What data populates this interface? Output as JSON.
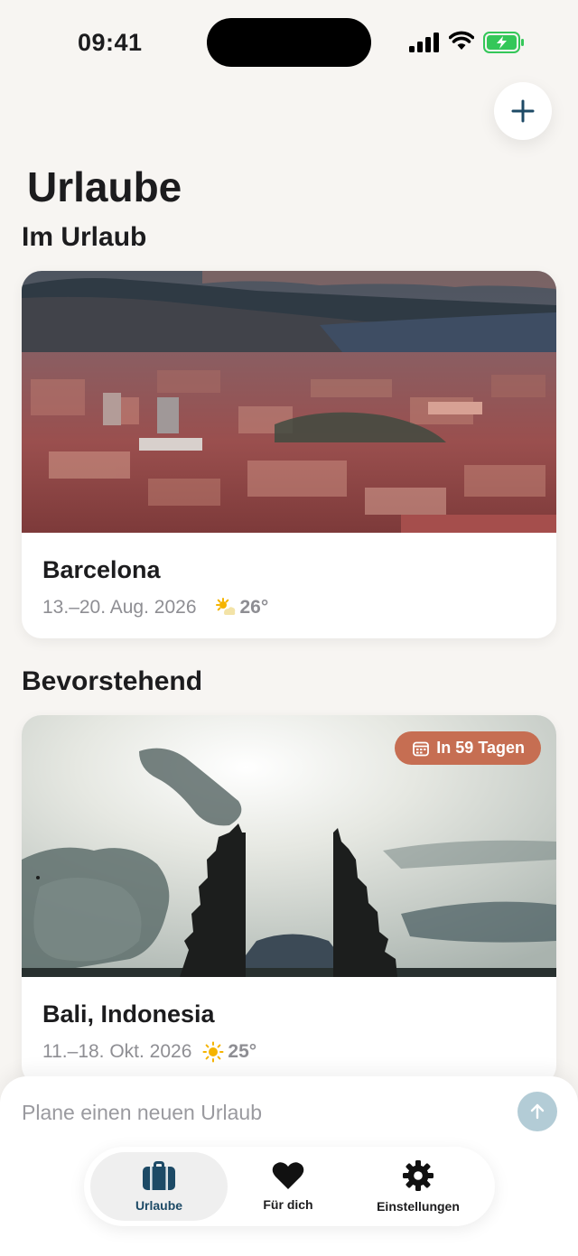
{
  "status_bar": {
    "time": "09:41"
  },
  "header": {
    "title": "Urlaube"
  },
  "sections": {
    "current": "Im Urlaub",
    "upcoming": "Bevorstehend"
  },
  "trips": [
    {
      "name": "Barcelona",
      "dates": "13.–20. Aug. 2026",
      "weather_icon": "sun-cloud-icon",
      "temperature": "26°"
    },
    {
      "name": "Bali, Indonesia",
      "dates": "11.–18. Okt. 2026",
      "weather_icon": "sun-icon",
      "temperature": "25°",
      "badge": "In 59 Tagen"
    }
  ],
  "composer": {
    "placeholder": "Plane einen neuen Urlaub"
  },
  "tabs": [
    {
      "label": "Urlaube",
      "icon": "suitcase-icon",
      "active": true
    },
    {
      "label": "Für dich",
      "icon": "heart-icon",
      "active": false
    },
    {
      "label": "Einstellungen",
      "icon": "gear-icon",
      "active": false
    }
  ],
  "colors": {
    "background": "#f7f5f2",
    "accent": "#1d4a66",
    "badge": "#c66e52",
    "sun": "#f5b400",
    "send_button": "#b3ccd6",
    "battery": "#34c759"
  }
}
